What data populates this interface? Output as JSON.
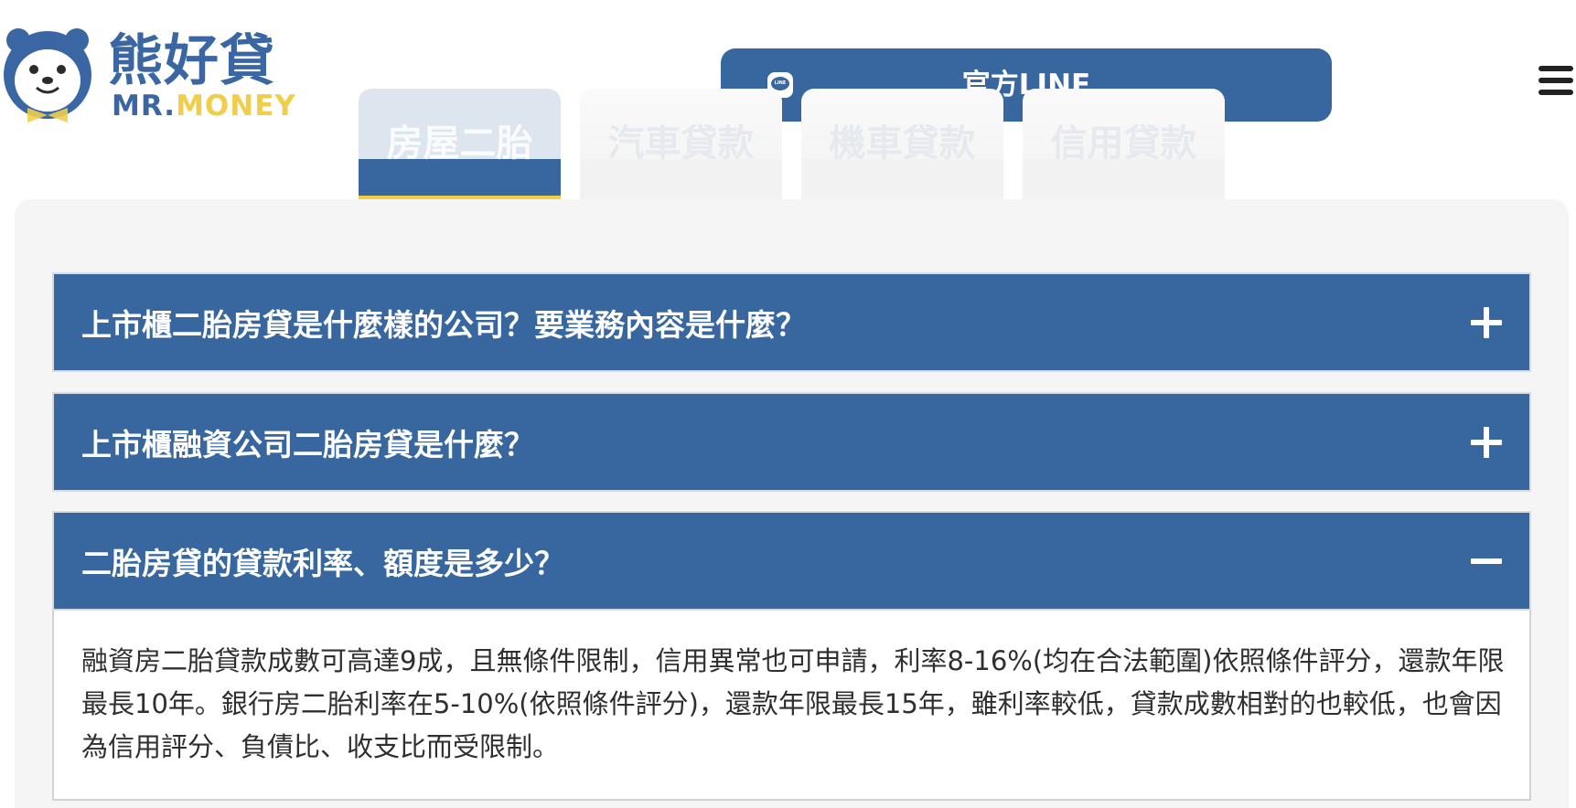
{
  "header": {
    "logo_cn": "熊好貸",
    "logo_en_mr": "MR.",
    "logo_en_money": "MONEY",
    "line_button": {
      "icon_text": "LINE",
      "label": "官方LINE"
    }
  },
  "tabs": [
    {
      "label": "房屋二胎",
      "active": true
    },
    {
      "label": "汽車貸款",
      "active": false
    },
    {
      "label": "機車貸款",
      "active": false
    },
    {
      "label": "信用貸款",
      "active": false
    }
  ],
  "faq": [
    {
      "question": "上市櫃二胎房貸是什麼樣的公司？要業務內容是什麼？",
      "expanded": false
    },
    {
      "question": "上市櫃融資公司二胎房貸是什麼？",
      "expanded": false
    },
    {
      "question": "二胎房貸的貸款利率、額度是多少？",
      "expanded": true,
      "answer": "融資房二胎貸款成數可高達9成，且無條件限制，信用異常也可申請，利率8-16%(均在合法範圍)依照條件評分，還款年限最長10年。銀行房二胎利率在5-10%(依照條件評分)，還款年限最長15年，雖利率較低，貸款成數相對的也較低，也會因為信用評分、負債比、收支比而受限制。"
    }
  ],
  "colors": {
    "brand_blue": "#38669e",
    "accent_yellow": "#f1ce4a",
    "panel_bg": "#f5f5f5"
  }
}
